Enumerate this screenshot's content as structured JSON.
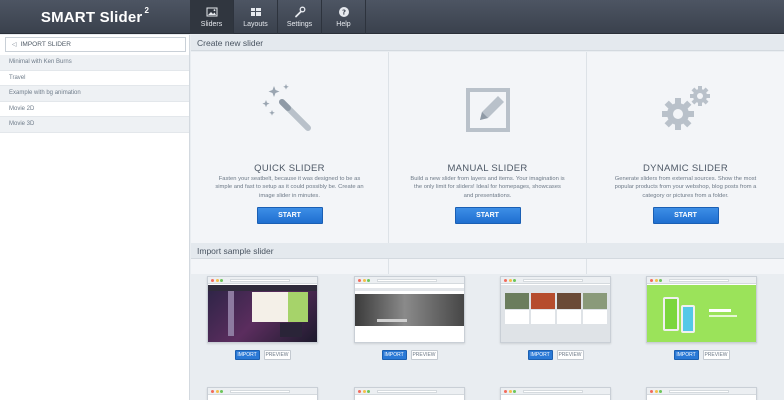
{
  "app": {
    "brand": "SMART Slider",
    "version": "2"
  },
  "nav": [
    {
      "label": "Sliders",
      "icon": "image-icon",
      "active": true
    },
    {
      "label": "Layouts",
      "icon": "grid-icon",
      "active": false
    },
    {
      "label": "Settings",
      "icon": "wrench-icon",
      "active": false
    },
    {
      "label": "Help",
      "icon": "help-icon",
      "active": false
    }
  ],
  "sidebar": {
    "import_label": "IMPORT SLIDER",
    "items": [
      {
        "label": "Minimal with Ken Burns"
      },
      {
        "label": "Travel"
      },
      {
        "label": "Example with bg animation"
      },
      {
        "label": "Movie 2D"
      },
      {
        "label": "Movie 3D"
      }
    ]
  },
  "create": {
    "heading": "Create new slider",
    "cards": [
      {
        "title": "QUICK SLIDER",
        "desc": "Fasten your seatbelt, because it was designed to be as simple and fast to setup as it could possibly be. Create an image slider in minutes.",
        "button": "START",
        "icon": "magic-wand-icon"
      },
      {
        "title": "MANUAL SLIDER",
        "desc": "Build a new slider from layers and items. Your imagination is the only limit for sliders! Ideal for homepages, showcases and presentations.",
        "button": "START",
        "icon": "pencil-icon"
      },
      {
        "title": "DYNAMIC SLIDER",
        "desc": "Generate sliders from external sources. Show the most popular products from your webshop, blog posts from a category or pictures from a folder.",
        "button": "START",
        "icon": "gears-icon"
      }
    ]
  },
  "samples": {
    "heading": "Import sample slider",
    "import_label": "IMPORT",
    "preview_label": "PREVIEW",
    "colors": {
      "accent": "#2a79d6",
      "lime": "#9be35a"
    }
  }
}
